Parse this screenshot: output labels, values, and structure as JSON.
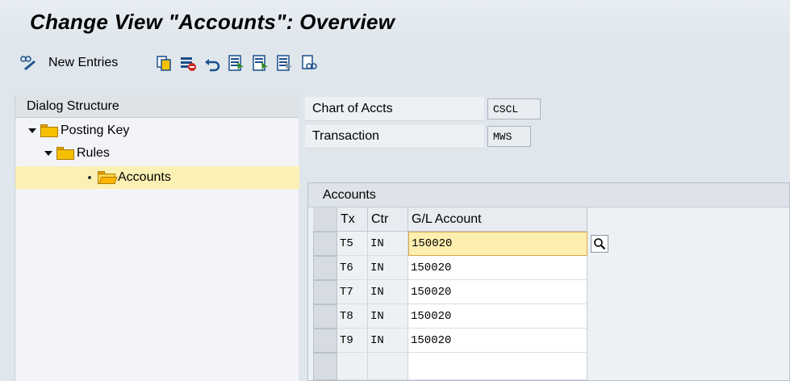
{
  "title": "Change View \"Accounts\": Overview",
  "toolbar": {
    "new_entries_label": "New Entries",
    "icons": [
      "display-change-icon",
      "copy-icon",
      "delete-icon",
      "undo-icon",
      "select-all-icon",
      "select-block-icon",
      "deselect-all-icon",
      "print-field-icon"
    ]
  },
  "dialog_structure": {
    "header": "Dialog Structure",
    "items": [
      {
        "label": "Posting Key",
        "level": 0,
        "expanded": true
      },
      {
        "label": "Rules",
        "level": 1,
        "expanded": true
      },
      {
        "label": "Accounts",
        "level": 2,
        "selected": true
      }
    ]
  },
  "fields": {
    "chart_of_accts_label": "Chart of Accts",
    "chart_of_accts_value": "CSCL",
    "transaction_label": "Transaction",
    "transaction_value": "MWS"
  },
  "table": {
    "title": "Accounts",
    "columns": [
      "Tx",
      "Ctr",
      "G/L Account"
    ],
    "rows": [
      {
        "tx": "T5",
        "ctr": "IN",
        "gl": "150020"
      },
      {
        "tx": "T6",
        "ctr": "IN",
        "gl": "150020"
      },
      {
        "tx": "T7",
        "ctr": "IN",
        "gl": "150020"
      },
      {
        "tx": "T8",
        "ctr": "IN",
        "gl": "150020"
      },
      {
        "tx": "T9",
        "ctr": "IN",
        "gl": "150020"
      }
    ]
  },
  "colors": {
    "background": "#dfe6ec",
    "selection": "#fbf1b4",
    "focus_cell": "#fdefb0",
    "focus_border": "#d9262a"
  }
}
